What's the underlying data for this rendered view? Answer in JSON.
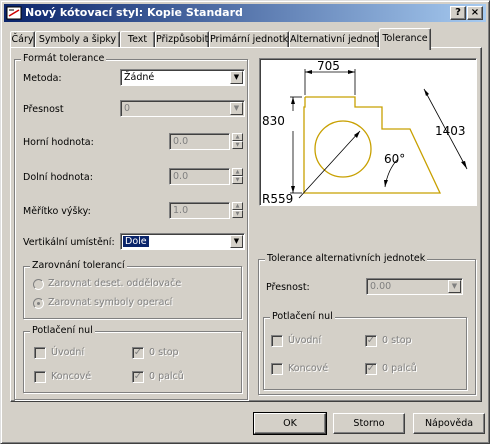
{
  "window": {
    "title": "Nový kótovací styl: Kopie Standard",
    "help_label": "?",
    "close_label": "×"
  },
  "tabs": [
    "Čáry",
    "Symboly a šipky",
    "Text",
    "Přizpůsobit",
    "Primární jednotky",
    "Alternativní jednotky",
    "Tolerance"
  ],
  "tolerance_format": {
    "title": "Formát tolerance",
    "method_label": "Metoda:",
    "method_value": "Žádné",
    "precision_label": "Přesnost",
    "precision_value": "0",
    "upper_label": "Horní hodnota:",
    "upper_value": "0.0",
    "lower_label": "Dolní hodnota:",
    "lower_value": "0.0",
    "scale_label": "Měřítko výšky:",
    "scale_value": "1.0",
    "vpos_label": "Vertikální umístění:",
    "vpos_value": "Dole"
  },
  "alignment": {
    "title": "Zarovnání tolerancí",
    "opt1": "Zarovnat deset. oddělovače",
    "opt2": "Zarovnat symboly operací"
  },
  "zero_suppression": {
    "title": "Potlačení nul",
    "leading": "Úvodní",
    "trailing": "Koncové",
    "feet": "0 stop",
    "inches": "0 palců"
  },
  "alt_tolerance": {
    "title": "Tolerance alternativních jednotek",
    "precision_label": "Přesnost:",
    "precision_value": "0.00"
  },
  "alt_zero_suppression": {
    "title": "Potlačení nul",
    "leading": "Úvodní",
    "trailing": "Koncové",
    "feet": "0 stop",
    "inches": "0 palců"
  },
  "preview": {
    "dim_top": "705",
    "dim_left": "830",
    "dim_right": "1403",
    "angle": "60°",
    "radius": "R559"
  },
  "buttons": {
    "ok": "OK",
    "cancel": "Storno",
    "help": "Nápověda"
  },
  "colors": {
    "title_start": "#0a246a",
    "title_end": "#a6caf0",
    "part_stroke": "#c8a000",
    "face": "#d4d0c8"
  }
}
